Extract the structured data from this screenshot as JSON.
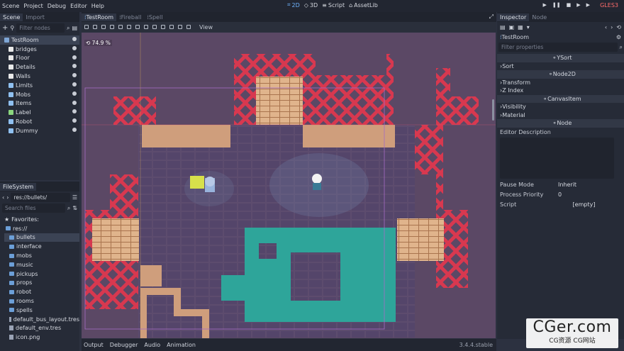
{
  "menubar": {
    "items": [
      "Scene",
      "Project",
      "Debug",
      "Editor",
      "Help"
    ],
    "workspaces": [
      {
        "label": "2D",
        "active": true
      },
      {
        "label": "3D",
        "active": false
      },
      {
        "label": "Script",
        "active": false
      },
      {
        "label": "AssetLib",
        "active": false
      }
    ],
    "renderer": "GLES3"
  },
  "scene_dock": {
    "tabs": [
      "Scene",
      "Import"
    ],
    "filter_placeholder": "Filter nodes",
    "nodes": [
      {
        "label": "TestRoom",
        "selected": true,
        "color": "#7fa6d6"
      },
      {
        "label": "bridges",
        "color": "#e8e8e8"
      },
      {
        "label": "Floor",
        "color": "#e8e8e8"
      },
      {
        "label": "Details",
        "color": "#e8e8e8"
      },
      {
        "label": "Walls",
        "color": "#e8e8e8"
      },
      {
        "label": "Limits",
        "color": "#8fc0f0"
      },
      {
        "label": "Mobs",
        "color": "#8fc0f0"
      },
      {
        "label": "Items",
        "color": "#8fc0f0"
      },
      {
        "label": "Label",
        "color": "#8ad67e"
      },
      {
        "label": "Robot",
        "color": "#8fc0f0"
      },
      {
        "label": "Dummy",
        "color": "#8fc0f0"
      }
    ]
  },
  "filesystem_dock": {
    "tab": "FileSystem",
    "path": "res://bullets/",
    "search_placeholder": "Search files",
    "items": [
      {
        "label": "Favorites:",
        "type": "star"
      },
      {
        "label": "res://",
        "type": "folder"
      },
      {
        "label": "bullets",
        "type": "folder",
        "selected": true
      },
      {
        "label": "interface",
        "type": "folder"
      },
      {
        "label": "mobs",
        "type": "folder"
      },
      {
        "label": "music",
        "type": "folder"
      },
      {
        "label": "pickups",
        "type": "folder"
      },
      {
        "label": "props",
        "type": "folder"
      },
      {
        "label": "robot",
        "type": "folder"
      },
      {
        "label": "rooms",
        "type": "folder"
      },
      {
        "label": "spells",
        "type": "folder"
      },
      {
        "label": "default_bus_layout.tres",
        "type": "file"
      },
      {
        "label": "default_env.tres",
        "type": "file"
      },
      {
        "label": "icon.png",
        "type": "file"
      }
    ]
  },
  "editor_tabs": [
    "TestRoom",
    "Fireball",
    "Spell"
  ],
  "viewport": {
    "view_menu": "View",
    "zoom": "74.9 %"
  },
  "inspector": {
    "tabs": [
      "Inspector",
      "Node"
    ],
    "node_name": "TestRoom",
    "filter_placeholder": "Filter properties",
    "rows": [
      {
        "label": "YSort",
        "kind": "section"
      },
      {
        "label": "Sort",
        "kind": "group"
      },
      {
        "label": "Node2D",
        "kind": "section"
      },
      {
        "label": "Transform",
        "kind": "group"
      },
      {
        "label": "Z Index",
        "kind": "group"
      },
      {
        "label": "CanvasItem",
        "kind": "section"
      },
      {
        "label": "Visibility",
        "kind": "group"
      },
      {
        "label": "Material",
        "kind": "group"
      },
      {
        "label": "Node",
        "kind": "section"
      }
    ],
    "editor_description": "Editor Description",
    "properties": [
      {
        "key": "Pause Mode",
        "value": "Inherit"
      },
      {
        "key": "Process Priority",
        "value": "0"
      },
      {
        "key": "Script",
        "value": "[empty]"
      }
    ]
  },
  "bottom_panel": {
    "tabs": [
      "Output",
      "Debugger",
      "Audio",
      "Animation"
    ],
    "version": "3.4.4.stable"
  },
  "watermark": {
    "big": "CGer.com",
    "small": "CG资源 CG网站"
  },
  "colors": {
    "accent": "#6fb4ff",
    "x_pattern": "#d8384f",
    "water": "#2ea59a",
    "floor": "#5d4c6e"
  }
}
